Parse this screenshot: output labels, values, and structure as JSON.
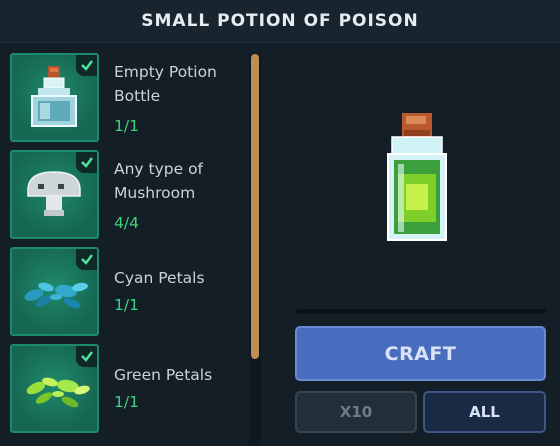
{
  "title": "SMALL POTION OF POISON",
  "ingredients": [
    {
      "name": "Empty Potion Bottle",
      "count": "1/1",
      "icon": "empty-potion-bottle-icon",
      "complete": true
    },
    {
      "name": "Any type of Mushroom",
      "count": "4/4",
      "icon": "mushroom-icon",
      "complete": true
    },
    {
      "name": "Cyan Petals",
      "count": "1/1",
      "icon": "cyan-petals-icon",
      "complete": true
    },
    {
      "name": "Green Petals",
      "count": "1/1",
      "icon": "green-petals-icon",
      "complete": true
    }
  ],
  "preview": {
    "icon": "poison-potion-icon"
  },
  "actions": {
    "craft_label": "CRAFT",
    "x10_label": "X10",
    "all_label": "ALL"
  },
  "colors": {
    "background": "#131e27",
    "header": "#18242e",
    "slot": "#176b55",
    "count_green": "#3ed37d",
    "craft_button": "#4a6cbf",
    "scrollbar": "#c08d52"
  }
}
